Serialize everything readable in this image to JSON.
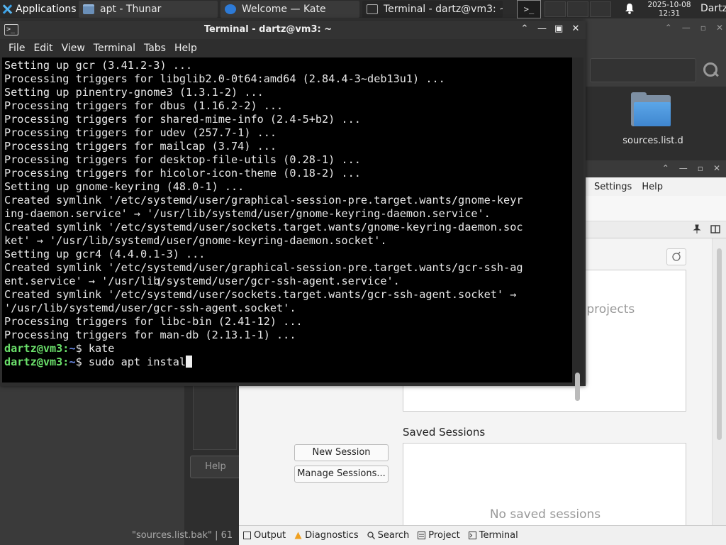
{
  "panel": {
    "apps_label": "Applications",
    "tasks": [
      {
        "label": "apt - Thunar",
        "icon": "folder-icon"
      },
      {
        "label": "Welcome  — Kate",
        "icon": "kate-icon"
      },
      {
        "label": "Terminal - dartz@vm3: ~",
        "icon": "terminal-icon"
      }
    ],
    "clock_date": "2025-10-08",
    "clock_time": "12:31",
    "user": "Dartz"
  },
  "thunar": {
    "folder_label": "sources.list.d"
  },
  "kate": {
    "menu": [
      "Settings",
      "Help"
    ],
    "recent_hint": "r projects",
    "saved_sessions_title": "Saved Sessions",
    "no_saved_sessions": "No saved sessions",
    "new_session_label": "New Session",
    "manage_sessions_label": "Manage Sessions...",
    "help_label": "Help",
    "status_file": "\"sources.list.bak\"  |  61",
    "status_items": [
      "Output",
      "Diagnostics",
      "Search",
      "Project",
      "Terminal"
    ]
  },
  "terminal": {
    "title": "Terminal - dartz@vm3: ~",
    "menu": [
      "File",
      "Edit",
      "View",
      "Terminal",
      "Tabs",
      "Help"
    ],
    "lines": [
      "Setting up gcr (3.41.2-3) ...",
      "Processing triggers for libglib2.0-0t64:amd64 (2.84.4-3~deb13u1) ...",
      "Setting up pinentry-gnome3 (1.3.1-2) ...",
      "Processing triggers for dbus (1.16.2-2) ...",
      "Processing triggers for shared-mime-info (2.4-5+b2) ...",
      "Processing triggers for udev (257.7-1) ...",
      "Processing triggers for mailcap (3.74) ...",
      "Processing triggers for desktop-file-utils (0.28-1) ...",
      "Processing triggers for hicolor-icon-theme (0.18-2) ...",
      "Setting up gnome-keyring (48.0-1) ...",
      "Created symlink '/etc/systemd/user/graphical-session-pre.target.wants/gnome-keyr",
      "ing-daemon.service' → '/usr/lib/systemd/user/gnome-keyring-daemon.service'.",
      "Created symlink '/etc/systemd/user/sockets.target.wants/gnome-keyring-daemon.soc",
      "ket' → '/usr/lib/systemd/user/gnome-keyring-daemon.socket'.",
      "Setting up gcr4 (4.4.0.1-3) ...",
      "Created symlink '/etc/systemd/user/graphical-session-pre.target.wants/gcr-ssh-ag",
      "ent.service' → '/usr/lib/systemd/user/gcr-ssh-agent.service'.",
      "Created symlink '/etc/systemd/user/sockets.target.wants/gcr-ssh-agent.socket' →",
      "'/usr/lib/systemd/user/gcr-ssh-agent.socket'.",
      "Processing triggers for libc-bin (2.41-12) ...",
      "Processing triggers for man-db (2.13.1-1) ..."
    ],
    "prompts": [
      {
        "user": "dartz@vm3",
        "path": "~",
        "symbol": "$",
        "command": "kate"
      },
      {
        "user": "dartz@vm3",
        "path": "~",
        "symbol": "$",
        "command": "sudo apt instal"
      }
    ]
  }
}
